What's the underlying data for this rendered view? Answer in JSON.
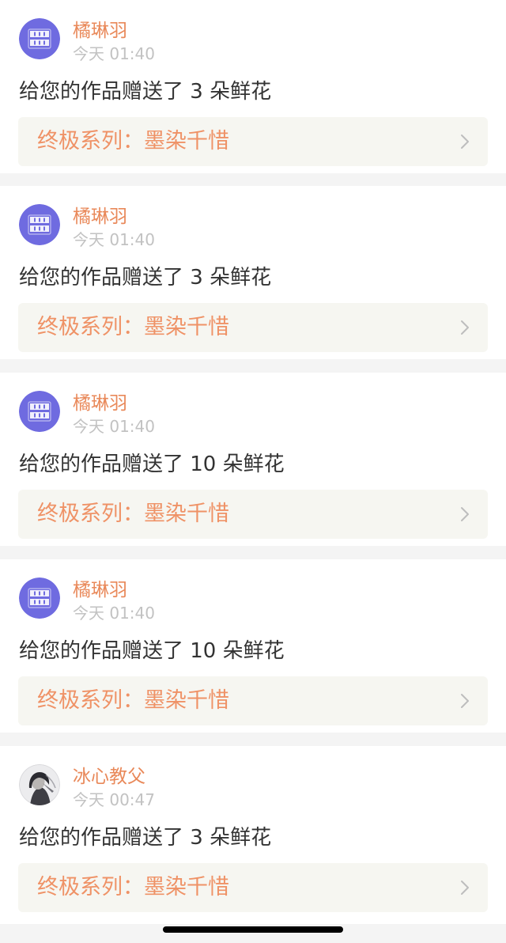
{
  "notifications": [
    {
      "username": "橘琳羽",
      "time": "今天 01:40",
      "message": "给您的作品赠送了 3 朵鲜花",
      "work_title": "终极系列：墨染千惜",
      "avatar": "brand-logo-avatar"
    },
    {
      "username": "橘琳羽",
      "time": "今天 01:40",
      "message": "给您的作品赠送了 3 朵鲜花",
      "work_title": "终极系列：墨染千惜",
      "avatar": "brand-logo-avatar"
    },
    {
      "username": "橘琳羽",
      "time": "今天 01:40",
      "message": "给您的作品赠送了 10 朵鲜花",
      "work_title": "终极系列：墨染千惜",
      "avatar": "brand-logo-avatar"
    },
    {
      "username": "橘琳羽",
      "time": "今天 01:40",
      "message": "给您的作品赠送了 10 朵鲜花",
      "work_title": "终极系列：墨染千惜",
      "avatar": "brand-logo-avatar"
    },
    {
      "username": "冰心教父",
      "time": "今天 00:47",
      "message": "给您的作品赠送了 3 朵鲜花",
      "work_title": "终极系列：墨染千惜",
      "avatar": "photo-avatar"
    }
  ],
  "colors": {
    "username": "#e9895a",
    "time": "#c2c2c2",
    "message": "#333333",
    "work_title": "#ef9266",
    "link_background": "#f6f6f1",
    "page_background": "#f4f4f4",
    "avatar_brand": "#6f6be0"
  },
  "icons": {
    "chevron": "chevron-right-icon"
  }
}
